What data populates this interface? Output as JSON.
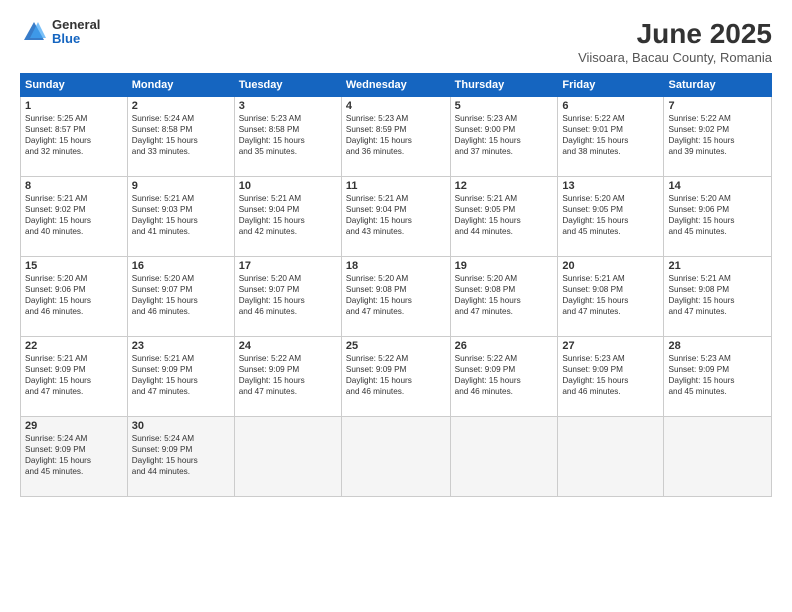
{
  "logo": {
    "general": "General",
    "blue": "Blue"
  },
  "header": {
    "month": "June 2025",
    "location": "Viisoara, Bacau County, Romania"
  },
  "weekdays": [
    "Sunday",
    "Monday",
    "Tuesday",
    "Wednesday",
    "Thursday",
    "Friday",
    "Saturday"
  ],
  "weeks": [
    [
      {
        "day": "1",
        "info": "Sunrise: 5:25 AM\nSunset: 8:57 PM\nDaylight: 15 hours\nand 32 minutes."
      },
      {
        "day": "2",
        "info": "Sunrise: 5:24 AM\nSunset: 8:58 PM\nDaylight: 15 hours\nand 33 minutes."
      },
      {
        "day": "3",
        "info": "Sunrise: 5:23 AM\nSunset: 8:58 PM\nDaylight: 15 hours\nand 35 minutes."
      },
      {
        "day": "4",
        "info": "Sunrise: 5:23 AM\nSunset: 8:59 PM\nDaylight: 15 hours\nand 36 minutes."
      },
      {
        "day": "5",
        "info": "Sunrise: 5:23 AM\nSunset: 9:00 PM\nDaylight: 15 hours\nand 37 minutes."
      },
      {
        "day": "6",
        "info": "Sunrise: 5:22 AM\nSunset: 9:01 PM\nDaylight: 15 hours\nand 38 minutes."
      },
      {
        "day": "7",
        "info": "Sunrise: 5:22 AM\nSunset: 9:02 PM\nDaylight: 15 hours\nand 39 minutes."
      }
    ],
    [
      {
        "day": "8",
        "info": "Sunrise: 5:21 AM\nSunset: 9:02 PM\nDaylight: 15 hours\nand 40 minutes."
      },
      {
        "day": "9",
        "info": "Sunrise: 5:21 AM\nSunset: 9:03 PM\nDaylight: 15 hours\nand 41 minutes."
      },
      {
        "day": "10",
        "info": "Sunrise: 5:21 AM\nSunset: 9:04 PM\nDaylight: 15 hours\nand 42 minutes."
      },
      {
        "day": "11",
        "info": "Sunrise: 5:21 AM\nSunset: 9:04 PM\nDaylight: 15 hours\nand 43 minutes."
      },
      {
        "day": "12",
        "info": "Sunrise: 5:21 AM\nSunset: 9:05 PM\nDaylight: 15 hours\nand 44 minutes."
      },
      {
        "day": "13",
        "info": "Sunrise: 5:20 AM\nSunset: 9:05 PM\nDaylight: 15 hours\nand 45 minutes."
      },
      {
        "day": "14",
        "info": "Sunrise: 5:20 AM\nSunset: 9:06 PM\nDaylight: 15 hours\nand 45 minutes."
      }
    ],
    [
      {
        "day": "15",
        "info": "Sunrise: 5:20 AM\nSunset: 9:06 PM\nDaylight: 15 hours\nand 46 minutes."
      },
      {
        "day": "16",
        "info": "Sunrise: 5:20 AM\nSunset: 9:07 PM\nDaylight: 15 hours\nand 46 minutes."
      },
      {
        "day": "17",
        "info": "Sunrise: 5:20 AM\nSunset: 9:07 PM\nDaylight: 15 hours\nand 46 minutes."
      },
      {
        "day": "18",
        "info": "Sunrise: 5:20 AM\nSunset: 9:08 PM\nDaylight: 15 hours\nand 47 minutes."
      },
      {
        "day": "19",
        "info": "Sunrise: 5:20 AM\nSunset: 9:08 PM\nDaylight: 15 hours\nand 47 minutes."
      },
      {
        "day": "20",
        "info": "Sunrise: 5:21 AM\nSunset: 9:08 PM\nDaylight: 15 hours\nand 47 minutes."
      },
      {
        "day": "21",
        "info": "Sunrise: 5:21 AM\nSunset: 9:08 PM\nDaylight: 15 hours\nand 47 minutes."
      }
    ],
    [
      {
        "day": "22",
        "info": "Sunrise: 5:21 AM\nSunset: 9:09 PM\nDaylight: 15 hours\nand 47 minutes."
      },
      {
        "day": "23",
        "info": "Sunrise: 5:21 AM\nSunset: 9:09 PM\nDaylight: 15 hours\nand 47 minutes."
      },
      {
        "day": "24",
        "info": "Sunrise: 5:22 AM\nSunset: 9:09 PM\nDaylight: 15 hours\nand 47 minutes."
      },
      {
        "day": "25",
        "info": "Sunrise: 5:22 AM\nSunset: 9:09 PM\nDaylight: 15 hours\nand 46 minutes."
      },
      {
        "day": "26",
        "info": "Sunrise: 5:22 AM\nSunset: 9:09 PM\nDaylight: 15 hours\nand 46 minutes."
      },
      {
        "day": "27",
        "info": "Sunrise: 5:23 AM\nSunset: 9:09 PM\nDaylight: 15 hours\nand 46 minutes."
      },
      {
        "day": "28",
        "info": "Sunrise: 5:23 AM\nSunset: 9:09 PM\nDaylight: 15 hours\nand 45 minutes."
      }
    ],
    [
      {
        "day": "29",
        "info": "Sunrise: 5:24 AM\nSunset: 9:09 PM\nDaylight: 15 hours\nand 45 minutes."
      },
      {
        "day": "30",
        "info": "Sunrise: 5:24 AM\nSunset: 9:09 PM\nDaylight: 15 hours\nand 44 minutes."
      },
      {
        "day": "",
        "info": ""
      },
      {
        "day": "",
        "info": ""
      },
      {
        "day": "",
        "info": ""
      },
      {
        "day": "",
        "info": ""
      },
      {
        "day": "",
        "info": ""
      }
    ]
  ]
}
